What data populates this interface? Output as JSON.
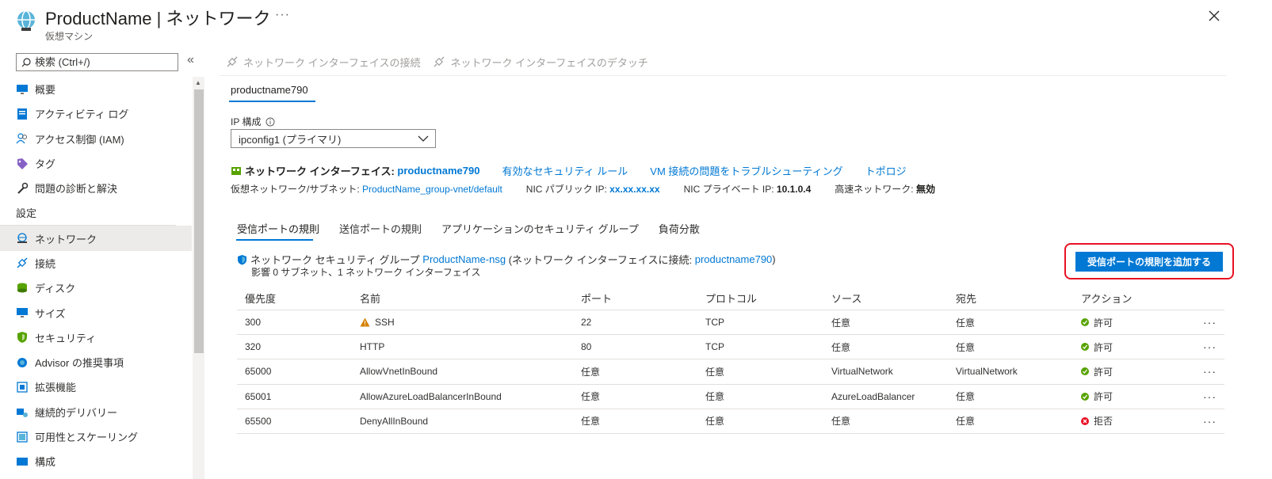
{
  "header": {
    "title": "ProductName | ネットワーク",
    "subtitle": "仮想マシン",
    "more": "···"
  },
  "sidebar": {
    "search_placeholder": "検索 (Ctrl+/)",
    "collapse": "«",
    "items": [
      {
        "label": "概要"
      },
      {
        "label": "アクティビティ ログ"
      },
      {
        "label": "アクセス制御 (IAM)"
      },
      {
        "label": "タグ"
      },
      {
        "label": "問題の診断と解決"
      }
    ],
    "section": "設定",
    "settings": [
      {
        "label": "ネットワーク"
      },
      {
        "label": "接続"
      },
      {
        "label": "ディスク"
      },
      {
        "label": "サイズ"
      },
      {
        "label": "セキュリティ"
      },
      {
        "label": "Advisor の推奨事項"
      },
      {
        "label": "拡張機能"
      },
      {
        "label": "継続的デリバリー"
      },
      {
        "label": "可用性とスケーリング"
      },
      {
        "label": "構成"
      }
    ]
  },
  "toolbar": {
    "attach": "ネットワーク インターフェイスの接続",
    "detach": "ネットワーク インターフェイスのデタッチ"
  },
  "nic": {
    "tab": "productname790",
    "ip_label": "IP 構成",
    "ip_value": "ipconfig1 (プライマリ)",
    "nic_label": "ネットワーク インターフェイス:",
    "nic_name": "productname790",
    "link_rules": "有効なセキュリティ ルール",
    "link_troubleshoot": "VM 接続の問題をトラブルシューティング",
    "link_topology": "トポロジ",
    "vnet_label": "仮想ネットワーク/サブネット:",
    "vnet_value": "ProductName_group-vnet/default",
    "pub_label": "NIC パブリック IP:",
    "pub_value": "xx.xx.xx.xx",
    "priv_label": "NIC プライベート IP:",
    "priv_value": "10.1.0.4",
    "accel_label": "高速ネットワーク:",
    "accel_value": "無効"
  },
  "rule_tabs": [
    "受信ポートの規則",
    "送信ポートの規則",
    "アプリケーションのセキュリティ グループ",
    "負荷分散"
  ],
  "nsg": {
    "prefix": "ネットワーク セキュリティ グループ",
    "name": "ProductName-nsg",
    "mid": "(ネットワーク インターフェイスに接続:",
    "nic": "productname790",
    "suffix": ")",
    "impact": "影響 0 サブネット、1 ネットワーク インターフェイス"
  },
  "add_button": "受信ポートの規則を追加する",
  "table": {
    "headers": [
      "優先度",
      "名前",
      "ポート",
      "プロトコル",
      "ソース",
      "宛先",
      "アクション"
    ],
    "rows": [
      {
        "priority": "300",
        "name": "SSH",
        "port": "22",
        "protocol": "TCP",
        "source": "任意",
        "dest": "任意",
        "action": "許可",
        "warn": true,
        "allow": true
      },
      {
        "priority": "320",
        "name": "HTTP",
        "port": "80",
        "protocol": "TCP",
        "source": "任意",
        "dest": "任意",
        "action": "許可",
        "warn": false,
        "allow": true
      },
      {
        "priority": "65000",
        "name": "AllowVnetInBound",
        "port": "任意",
        "protocol": "任意",
        "source": "VirtualNetwork",
        "dest": "VirtualNetwork",
        "action": "許可",
        "warn": false,
        "allow": true
      },
      {
        "priority": "65001",
        "name": "AllowAzureLoadBalancerInBound",
        "port": "任意",
        "protocol": "任意",
        "source": "AzureLoadBalancer",
        "dest": "任意",
        "action": "許可",
        "warn": false,
        "allow": true
      },
      {
        "priority": "65500",
        "name": "DenyAllInBound",
        "port": "任意",
        "protocol": "任意",
        "source": "任意",
        "dest": "任意",
        "action": "拒否",
        "warn": false,
        "allow": false
      }
    ],
    "more": "···"
  },
  "colors": {
    "accent": "#0078d4",
    "allow": "#57a300",
    "deny": "#e81123",
    "warn": "#d68100",
    "highlight": "#e81123"
  }
}
